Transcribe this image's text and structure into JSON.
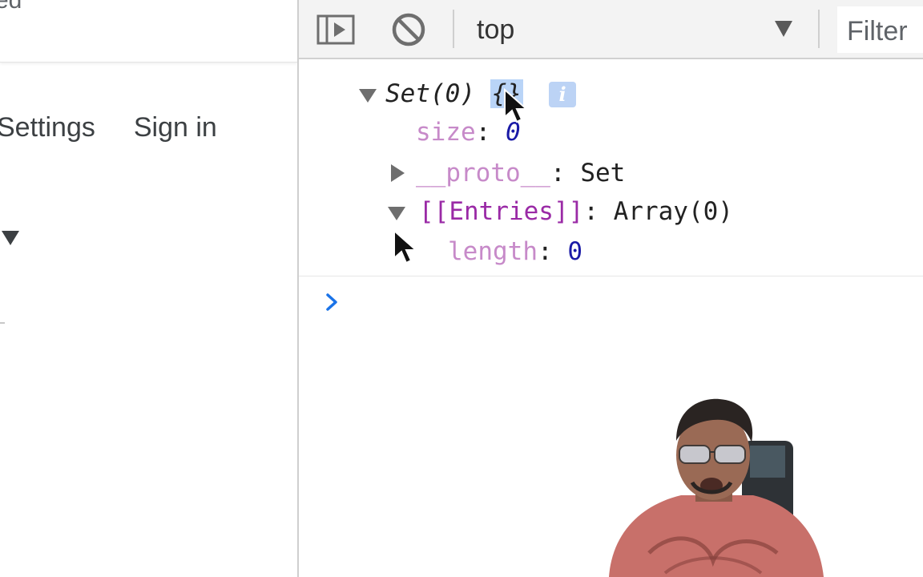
{
  "left_page": {
    "cut_text": "ed",
    "nav": [
      "Settings",
      "Sign in"
    ]
  },
  "toolbar": {
    "context": "top",
    "filter_placeholder": "Filter"
  },
  "console": {
    "set_title": "Set(0)",
    "set_braces": "{}",
    "info_badge": "i",
    "size_key": "size",
    "size_value": "0",
    "proto_key": "__proto__",
    "proto_value": "Set",
    "entries_key": "[[Entries]]",
    "entries_value": "Array(0)",
    "length_key": "length",
    "length_value": "0"
  },
  "colors": {
    "property_key": "#9a2aa6",
    "number": "#1a1aa6",
    "prompt": "#1a73e8",
    "selection": "#b9d4f7"
  }
}
